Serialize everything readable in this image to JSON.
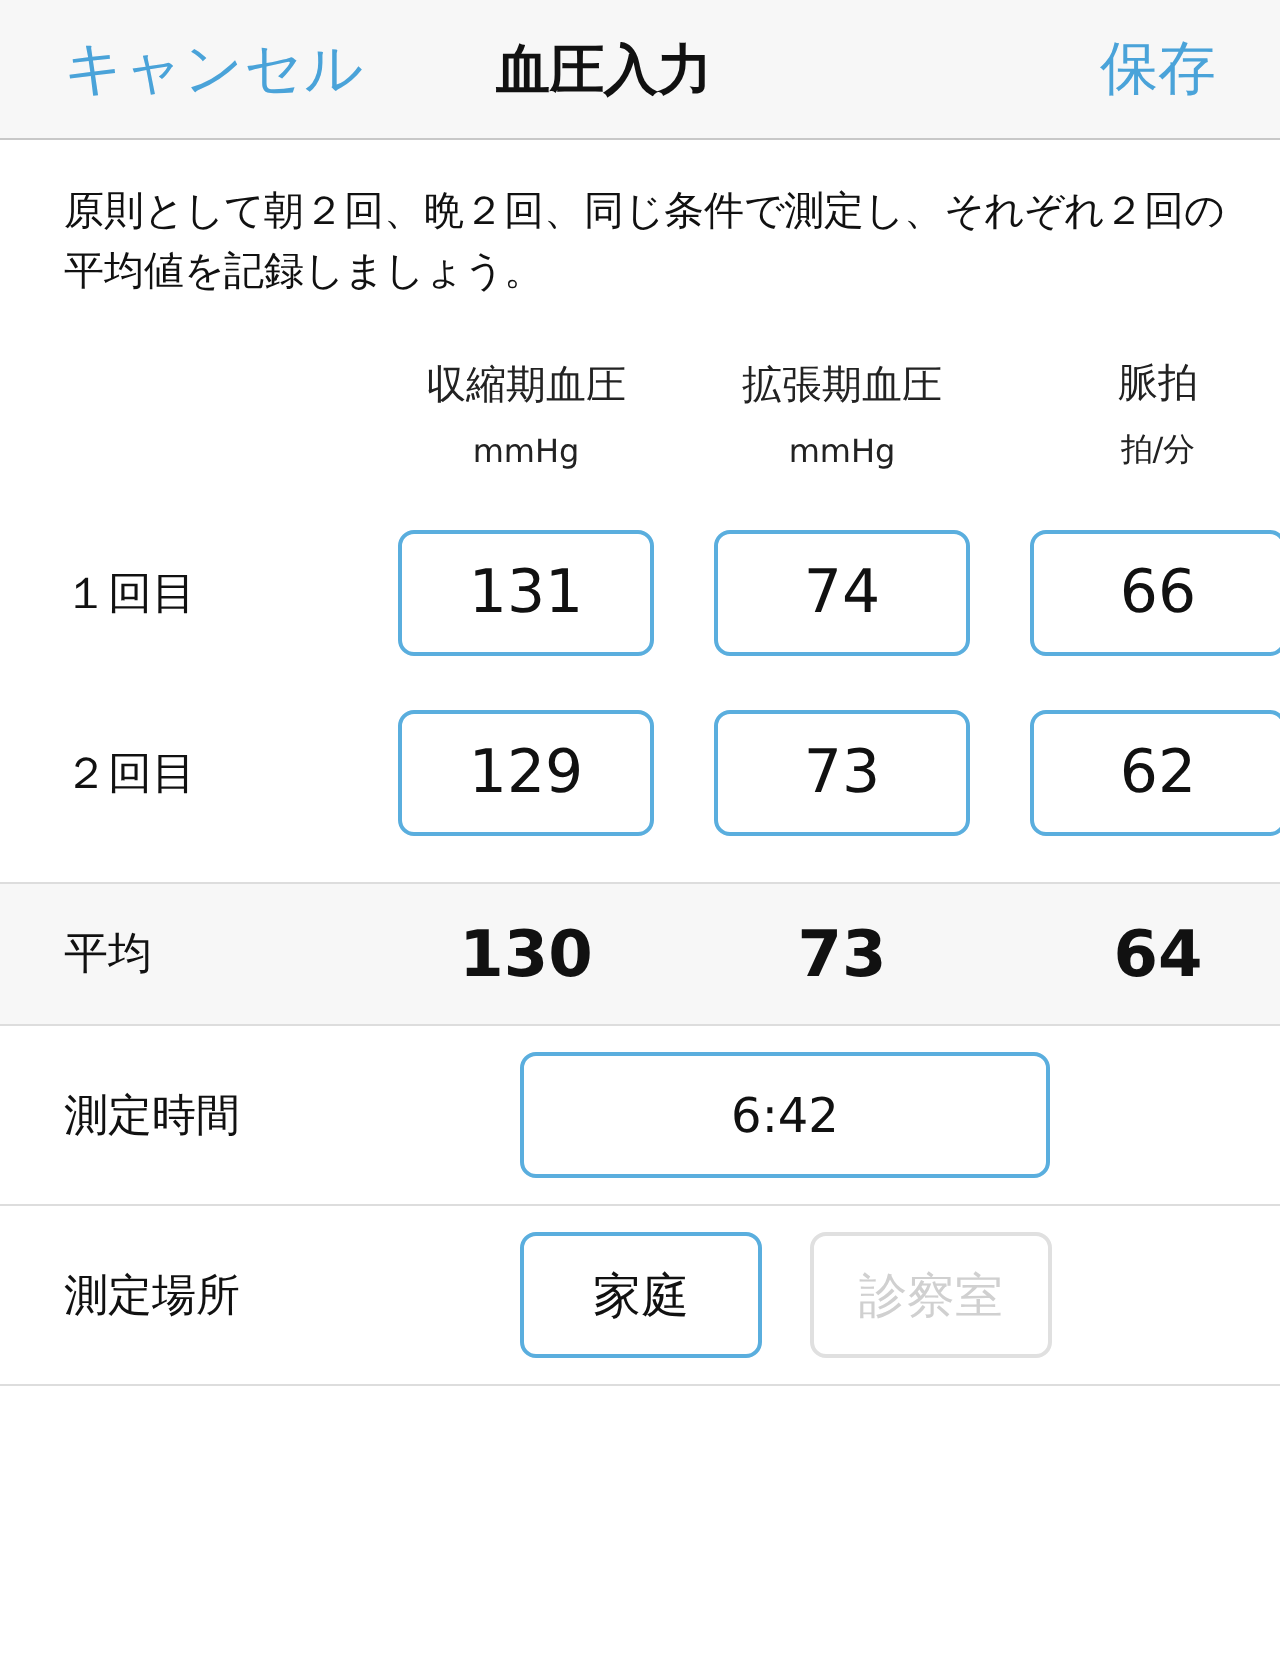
{
  "nav": {
    "cancel": "キャンセル",
    "title": "血圧入力",
    "save": "保存"
  },
  "intro": "原則として朝２回、晩２回、同じ条件で測定し、それぞれ２回の平均値を記録しましょう。",
  "columns": [
    {
      "label": "収縮期血圧",
      "unit": "mmHg"
    },
    {
      "label": "拡張期血圧",
      "unit": "mmHg"
    },
    {
      "label": "脈拍",
      "unit": "拍/分"
    }
  ],
  "readings": [
    {
      "label": "１回目",
      "values": [
        "131",
        "74",
        "66"
      ]
    },
    {
      "label": "２回目",
      "values": [
        "129",
        "73",
        "62"
      ]
    }
  ],
  "average": {
    "label": "平均",
    "values": [
      "130",
      "73",
      "64"
    ]
  },
  "time": {
    "label": "測定時間",
    "value": "6:42"
  },
  "place": {
    "label": "測定場所",
    "options": [
      {
        "label": "家庭",
        "selected": true
      },
      {
        "label": "診察室",
        "selected": false
      }
    ]
  }
}
